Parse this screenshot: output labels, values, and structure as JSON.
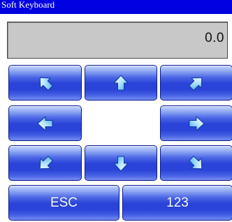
{
  "window": {
    "title": "Soft Keyboard"
  },
  "display": {
    "value": "0.0"
  },
  "keys": {
    "arrows": [
      {
        "id": "k-nw",
        "name": "arrow-up-left-button",
        "icon": "arrow-up-left-icon"
      },
      {
        "id": "k-n",
        "name": "arrow-up-button",
        "icon": "arrow-up-icon"
      },
      {
        "id": "k-ne",
        "name": "arrow-up-right-button",
        "icon": "arrow-up-right-icon"
      },
      {
        "id": "k-w",
        "name": "arrow-left-button",
        "icon": "arrow-left-icon"
      },
      {
        "id": "k-e",
        "name": "arrow-right-button",
        "icon": "arrow-right-icon"
      },
      {
        "id": "k-sw",
        "name": "arrow-down-left-button",
        "icon": "arrow-down-left-icon"
      },
      {
        "id": "k-s",
        "name": "arrow-down-button",
        "icon": "arrow-down-icon"
      },
      {
        "id": "k-se",
        "name": "arrow-down-right-button",
        "icon": "arrow-down-right-icon"
      }
    ],
    "esc_label": "ESC",
    "mode_label": "123"
  },
  "colors": {
    "titlebar": "#0000e0",
    "key_dark": "#2a43d8",
    "key_light": "#c9d8fa",
    "display_bg": "#c8c8c8"
  }
}
